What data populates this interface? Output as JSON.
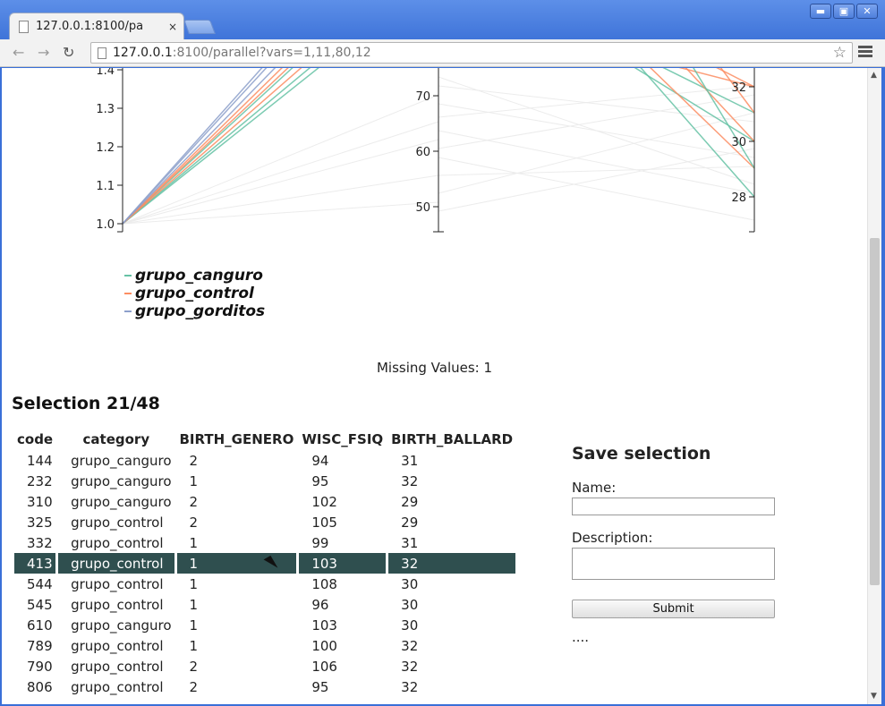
{
  "browser": {
    "tab_title": "127.0.0.1:8100/pa",
    "tab_close": "×",
    "url_host": "127.0.0.1",
    "url_rest": ":8100/parallel?vars=1,11,80,12",
    "back_glyph": "←",
    "forward_glyph": "→",
    "reload_glyph": "↻",
    "star_glyph": "☆",
    "minimize_glyph": "▬",
    "maximize_glyph": "▣",
    "close_glyph": "✕"
  },
  "chart_data": {
    "type": "parallel-coordinates",
    "axes": [
      {
        "name": "",
        "visible_range": [
          1.0,
          1.4
        ],
        "ticks": [
          "1.4",
          "1.3",
          "1.2",
          "1.1",
          "1.0"
        ]
      },
      {
        "name": "",
        "visible_range": [
          45,
          75
        ],
        "ticks": [
          "70",
          "60",
          "50"
        ]
      },
      {
        "name": "",
        "visible_range": [
          27,
          33
        ],
        "ticks": [
          "32",
          "30",
          "28"
        ]
      }
    ],
    "series_colors": {
      "grupo_canguro": "#66c2a5",
      "grupo_control": "#fc8d62",
      "grupo_gorditos": "#8da0cb"
    }
  },
  "legend": [
    {
      "label": "grupo_canguro",
      "color": "#66c2a5"
    },
    {
      "label": "grupo_control",
      "color": "#fc8d62"
    },
    {
      "label": "grupo_gorditos",
      "color": "#8da0cb"
    }
  ],
  "missing_values": "Missing Values: 1",
  "selection_title": "Selection 21/48",
  "table": {
    "columns": [
      "code",
      "category",
      "BIRTH_GENERO",
      "WISC_FSIQ",
      "BIRTH_BALLARD"
    ],
    "rows": [
      [
        "144",
        "grupo_canguro",
        "2",
        "94",
        "31"
      ],
      [
        "232",
        "grupo_canguro",
        "1",
        "95",
        "32"
      ],
      [
        "310",
        "grupo_canguro",
        "2",
        "102",
        "29"
      ],
      [
        "325",
        "grupo_control",
        "2",
        "105",
        "29"
      ],
      [
        "332",
        "grupo_control",
        "1",
        "99",
        "31"
      ],
      [
        "413",
        "grupo_control",
        "1",
        "103",
        "32"
      ],
      [
        "544",
        "grupo_control",
        "1",
        "108",
        "30"
      ],
      [
        "545",
        "grupo_control",
        "1",
        "96",
        "30"
      ],
      [
        "610",
        "grupo_canguro",
        "1",
        "103",
        "30"
      ],
      [
        "789",
        "grupo_control",
        "1",
        "100",
        "32"
      ],
      [
        "790",
        "grupo_control",
        "2",
        "106",
        "32"
      ],
      [
        "806",
        "grupo_control",
        "2",
        "95",
        "32"
      ]
    ],
    "highlighted_row": 5,
    "highlight_color": "#2f4f4f"
  },
  "save_form": {
    "title": "Save selection",
    "name_label": "Name:",
    "name_value": "",
    "description_label": "Description:",
    "description_value": "",
    "submit_label": "Submit",
    "status": "...."
  }
}
